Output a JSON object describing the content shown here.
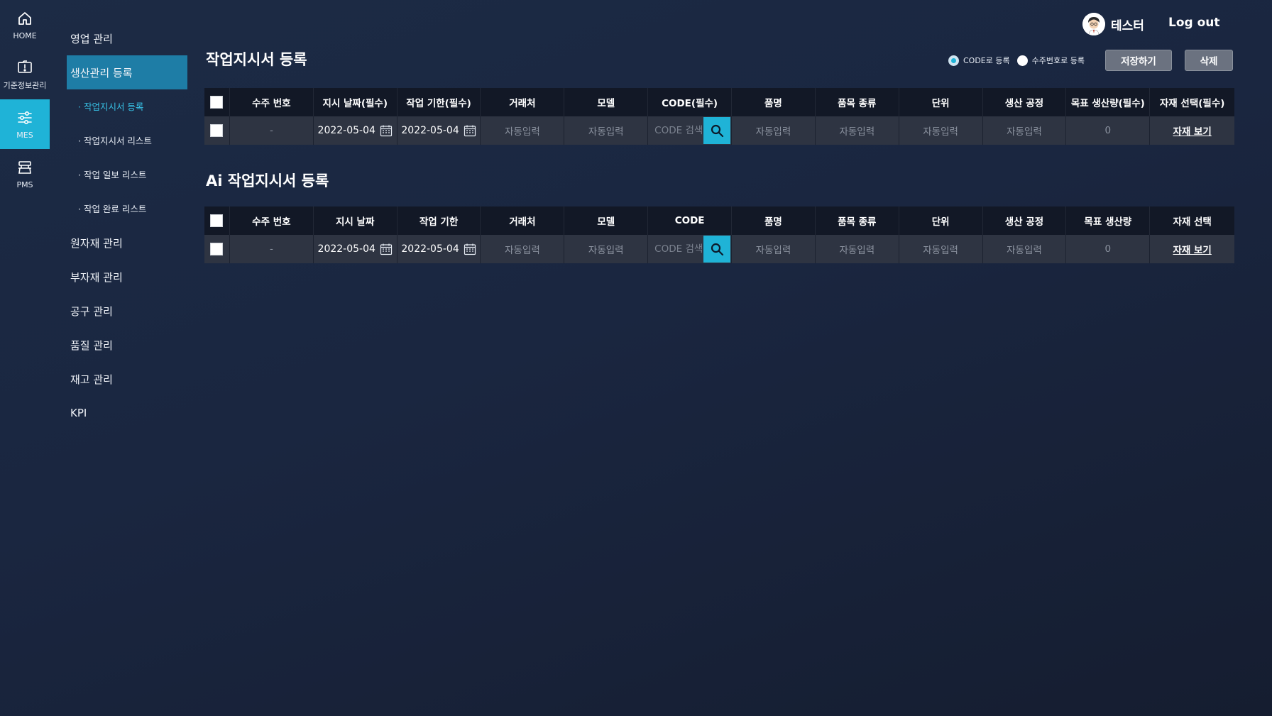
{
  "rail": {
    "items": [
      {
        "label": "HOME",
        "icon": "home-icon"
      },
      {
        "label": "기준정보관리",
        "icon": "folder-alert-icon"
      },
      {
        "label": "MES",
        "icon": "sliders-icon",
        "active": true
      },
      {
        "label": "PMS",
        "icon": "machine-icon"
      }
    ]
  },
  "menu": {
    "items": [
      {
        "label": "영업 관리"
      },
      {
        "label": "생산관리 등록",
        "active": true
      },
      {
        "label": "원자재 관리"
      },
      {
        "label": "부자재 관리"
      },
      {
        "label": "공구 관리"
      },
      {
        "label": "품질 관리"
      },
      {
        "label": "재고 관리"
      },
      {
        "label": "KPI"
      }
    ],
    "sub_items": [
      {
        "label": "· 작업지시서 등록",
        "active": true
      },
      {
        "label": "· 작업지시서 리스트"
      },
      {
        "label": "· 작업 일보 리스트"
      },
      {
        "label": "· 작업 완료 리스트"
      }
    ]
  },
  "header": {
    "user_name": "테스터",
    "logout_label": "Log out"
  },
  "controls": {
    "radio_code_label": "CODE로 등록",
    "radio_order_label": "수주번호로 등록",
    "save_label": "저장하기",
    "delete_label": "삭제"
  },
  "section1": {
    "title": "작업지시서 등록",
    "columns": [
      "수주 번호",
      "지시 날짜(필수)",
      "작업 기한(필수)",
      "거래처",
      "모델",
      "CODE(필수)",
      "품명",
      "품목 종류",
      "단위",
      "생산 공정",
      "목표 생산량(필수)",
      "자재 선택(필수)"
    ],
    "row": {
      "order_no": "-",
      "instruct_date": "2022-05-04",
      "deadline": "2022-05-04",
      "client": "자동입력",
      "model": "자동입력",
      "code_placeholder": "CODE 검색",
      "item_name": "자동입력",
      "item_type": "자동입력",
      "unit": "자동입력",
      "process": "자동입력",
      "target_qty": "0",
      "material_link": "자재 보기"
    }
  },
  "section2": {
    "title": "Ai 작업지시서 등록",
    "columns": [
      "수주 번호",
      "지시 날짜",
      "작업 기한",
      "거래처",
      "모델",
      "CODE",
      "품명",
      "품목 종류",
      "단위",
      "생산 공정",
      "목표 생산량",
      "자재 선택"
    ],
    "row": {
      "order_no": "-",
      "instruct_date": "2022-05-04",
      "deadline": "2022-05-04",
      "client": "자동입력",
      "model": "자동입력",
      "code_placeholder": "CODE 검색",
      "item_name": "자동입력",
      "item_type": "자동입력",
      "unit": "자동입력",
      "process": "자동입력",
      "target_qty": "0",
      "material_link": "자재 보기"
    }
  },
  "colors": {
    "accent": "#1fb3d7",
    "menu_active": "#1e7da6",
    "table_head": "#121826",
    "table_row": "#2e3442"
  }
}
